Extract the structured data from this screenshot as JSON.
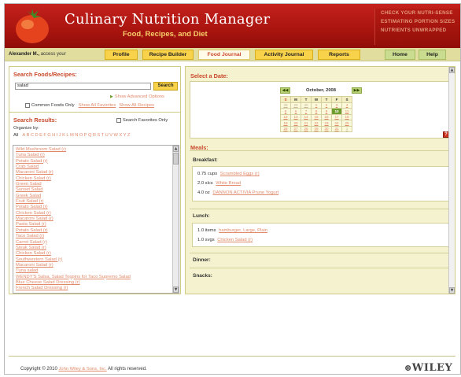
{
  "header": {
    "title": "Culinary Nutrition Manager",
    "subtitle": "Food, Recipes, and Diet",
    "promo_links": [
      "CHECK YOUR NUTRI-SENSE",
      "ESTIMATING PORTION SIZES",
      "NUTRIENTS UNWRAPPED"
    ]
  },
  "nav": {
    "user_name": "Alexander M.,",
    "user_suffix": "access your",
    "tabs": [
      "Profile",
      "Recipe Builder",
      "Food Journal",
      "Activity Journal",
      "Reports"
    ],
    "active_tab": "Food Journal",
    "right_tabs": [
      "Home",
      "Help"
    ]
  },
  "search": {
    "title": "Search Foods/Recipes:",
    "query": "salad",
    "button": "Search",
    "advanced_link": "Show Advanced Options",
    "common_only_label": "Common Foods Only",
    "show_all_favorites": "Show All Favorites",
    "show_all_recipes": "Show All Recipes"
  },
  "results": {
    "title": "Search Results:",
    "search_favorites_label": "Search Favorites Only",
    "organize_label": "Organize by:",
    "all_label": "All",
    "letters": [
      "A",
      "B",
      "C",
      "D",
      "E",
      "F",
      "G",
      "H",
      "I",
      "J",
      "K",
      "L",
      "M",
      "N",
      "O",
      "P",
      "Q",
      "R",
      "S",
      "T",
      "U",
      "V",
      "W",
      "X",
      "Y",
      "Z"
    ],
    "items": [
      "Wild Mushroom Salad (r)",
      "Tuna Salad (r)",
      "Potato Salad (r)",
      "Crab Salad",
      "Macaroni Salad (r)",
      "Chicken Salad (r)",
      "Green Salad",
      "Sunset Salad",
      "Greek Salad",
      "Fruit Salad (r)",
      "Potato Salad (r)",
      "Chicken Salad (r)",
      "Macaroni Salad (r)",
      "Pasta Salad (r)",
      "Potato Salad (r)",
      "Taco Salad (r)",
      "Carrot Salad (r)",
      "Steak Salad (r)",
      "Chicken Salad (r)",
      "Southwestern Salad (r)",
      "Macaroni Salad (r)",
      "Tuna salad",
      "WENDY'S Salsa, Salad Toppins for Taco Supremo Salad",
      "Blue Cheese Salad Dressing (r)",
      "French Salad Dressing (r)"
    ]
  },
  "date_panel": {
    "title": "Select a Date:",
    "month": "October, 2008",
    "prev_icon": "double-left-arrow-icon",
    "next_icon": "double-right-arrow-icon",
    "weekdays": [
      "S",
      "M",
      "T",
      "W",
      "T",
      "F",
      "S"
    ],
    "weeks": [
      [
        "28",
        "29",
        "30",
        "1",
        "2",
        "3",
        "4"
      ],
      [
        "5",
        "6",
        "7",
        "8",
        "9",
        "10",
        "11"
      ],
      [
        "12",
        "13",
        "14",
        "15",
        "16",
        "17",
        "18"
      ],
      [
        "19",
        "20",
        "21",
        "22",
        "23",
        "24",
        "25"
      ],
      [
        "26",
        "27",
        "28",
        "29",
        "30",
        "31",
        "1"
      ]
    ],
    "selected_day": "10",
    "help_icon": "?"
  },
  "meals": {
    "title": "Meals:",
    "breakfast_label": "Breakfast:",
    "breakfast": [
      {
        "amount": "0.75 cups",
        "food": "Scrambled Eggs (r)"
      },
      {
        "amount": "2.0 slcs",
        "food": "White Bread"
      },
      {
        "amount": "4.0 oz",
        "food": "DANNON ACTIVIA Prune Yogurt"
      }
    ],
    "lunch_label": "Lunch:",
    "lunch": [
      {
        "amount": "1.0 items",
        "food": "hamburger, Large, Plain"
      },
      {
        "amount": "1.0 svgs",
        "food": "Chicken Salad (r)"
      }
    ],
    "dinner_label": "Dinner:",
    "snacks_label": "Snacks:"
  },
  "footer": {
    "copyright": "Copyright © 2010",
    "company": "John Wiley & Sons, Inc.",
    "rights": "All rights reserved.",
    "brand": "WILEY"
  },
  "colors": {
    "header_red": "#b51a14",
    "accent_text": "#c9472a",
    "link": "#e08a6a",
    "tab_yellow": "#f8d24a",
    "tab_green": "#c9dc8f",
    "panel_bg": "#f5f3cf",
    "nav_bg": "#e0dd9f",
    "selected_day": "#6f9e2f"
  }
}
